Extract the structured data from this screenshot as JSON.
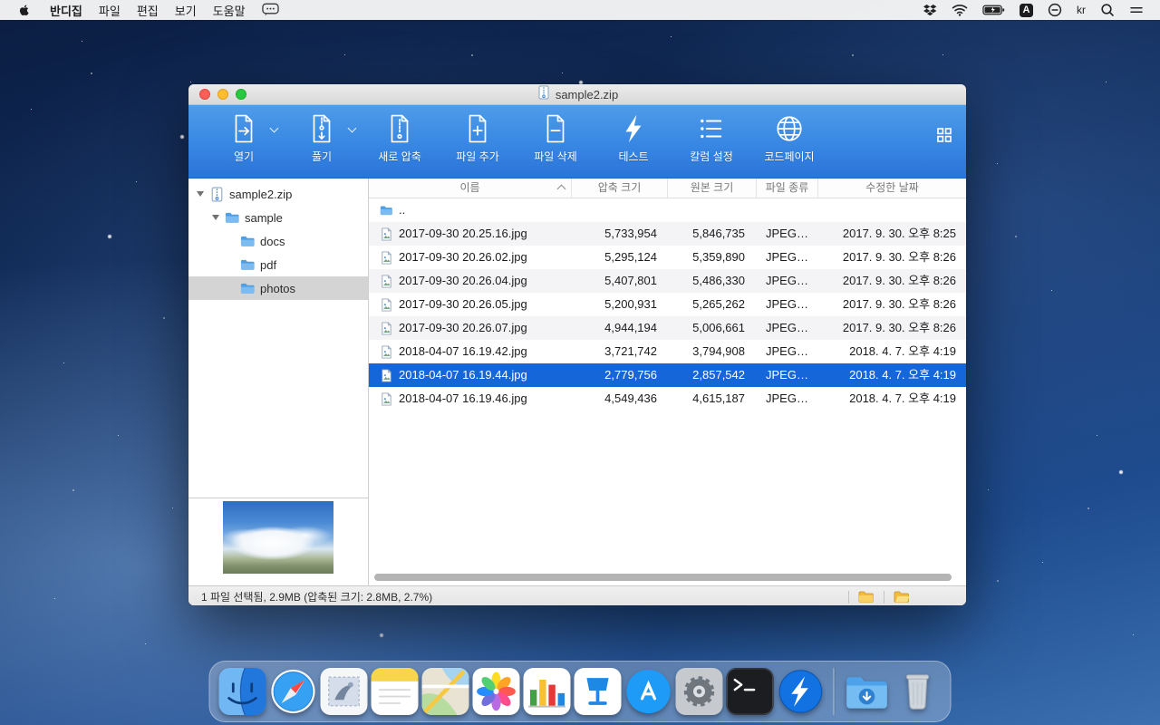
{
  "menubar": {
    "menus": [
      {
        "label": "반디집",
        "bold": true
      },
      {
        "label": "파일",
        "bold": false
      },
      {
        "label": "편집",
        "bold": false
      },
      {
        "label": "보기",
        "bold": false
      },
      {
        "label": "도움말",
        "bold": false
      }
    ],
    "input_badge": "A",
    "language": "kr"
  },
  "window": {
    "title": "sample2.zip",
    "toolbar": {
      "items": [
        {
          "id": "open",
          "label": "열기",
          "chevron": true
        },
        {
          "id": "extract",
          "label": "풀기",
          "chevron": true
        },
        {
          "id": "new-archive",
          "label": "새로 압축",
          "chevron": false
        },
        {
          "id": "add-file",
          "label": "파일 추가",
          "chevron": false
        },
        {
          "id": "delete-file",
          "label": "파일 삭제",
          "chevron": false
        },
        {
          "id": "test",
          "label": "테스트",
          "chevron": false
        },
        {
          "id": "column-settings",
          "label": "칼럼 설정",
          "chevron": false
        },
        {
          "id": "codepage",
          "label": "코드페이지",
          "chevron": false
        }
      ]
    },
    "sidebar": {
      "items": [
        {
          "label": "sample2.zip",
          "icon": "zip-file",
          "depth": 0,
          "expanded": true,
          "selected": false
        },
        {
          "label": "sample",
          "icon": "folder",
          "depth": 1,
          "expanded": true,
          "selected": false
        },
        {
          "label": "docs",
          "icon": "folder",
          "depth": 2,
          "selected": false
        },
        {
          "label": "pdf",
          "icon": "folder",
          "depth": 2,
          "selected": false
        },
        {
          "label": "photos",
          "icon": "folder",
          "depth": 2,
          "selected": true
        }
      ]
    },
    "table": {
      "columns": [
        "이름",
        "압축 크기",
        "원본 크기",
        "파일 종류",
        "수정한 날짜"
      ],
      "rows": [
        {
          "name": "..",
          "icon": "folder-up",
          "packed": "",
          "original": "",
          "type": "",
          "date": "",
          "selected": false
        },
        {
          "name": "2017-09-30 20.25.16.jpg",
          "icon": "image-file",
          "packed": "5,733,954",
          "original": "5,846,735",
          "type": "JPEG…",
          "date": "2017. 9. 30. 오후 8:25",
          "selected": false
        },
        {
          "name": "2017-09-30 20.26.02.jpg",
          "icon": "image-file",
          "packed": "5,295,124",
          "original": "5,359,890",
          "type": "JPEG…",
          "date": "2017. 9. 30. 오후 8:26",
          "selected": false
        },
        {
          "name": "2017-09-30 20.26.04.jpg",
          "icon": "image-file",
          "packed": "5,407,801",
          "original": "5,486,330",
          "type": "JPEG…",
          "date": "2017. 9. 30. 오후 8:26",
          "selected": false
        },
        {
          "name": "2017-09-30 20.26.05.jpg",
          "icon": "image-file",
          "packed": "5,200,931",
          "original": "5,265,262",
          "type": "JPEG…",
          "date": "2017. 9. 30. 오후 8:26",
          "selected": false
        },
        {
          "name": "2017-09-30 20.26.07.jpg",
          "icon": "image-file",
          "packed": "4,944,194",
          "original": "5,006,661",
          "type": "JPEG…",
          "date": "2017. 9. 30. 오후 8:26",
          "selected": false
        },
        {
          "name": "2018-04-07 16.19.42.jpg",
          "icon": "image-file",
          "packed": "3,721,742",
          "original": "3,794,908",
          "type": "JPEG…",
          "date": "2018. 4. 7. 오후 4:19",
          "selected": false
        },
        {
          "name": "2018-04-07 16.19.44.jpg",
          "icon": "image-file",
          "packed": "2,779,756",
          "original": "2,857,542",
          "type": "JPEG…",
          "date": "2018. 4. 7. 오후 4:19",
          "selected": true
        },
        {
          "name": "2018-04-07 16.19.46.jpg",
          "icon": "image-file",
          "packed": "4,549,436",
          "original": "4,615,187",
          "type": "JPEG…",
          "date": "2018. 4. 7. 오후 4:19",
          "selected": false
        }
      ]
    },
    "statusbar": {
      "text": "1 파일 선택됨, 2.9MB (압축된 크기: 2.8MB, 2.7%)"
    }
  },
  "dock": {
    "apps": [
      {
        "id": "finder"
      },
      {
        "id": "safari"
      },
      {
        "id": "mail"
      },
      {
        "id": "notes"
      },
      {
        "id": "maps"
      },
      {
        "id": "photos"
      },
      {
        "id": "numbers"
      },
      {
        "id": "keynote"
      },
      {
        "id": "app-store"
      },
      {
        "id": "system-preferences"
      },
      {
        "id": "terminal"
      },
      {
        "id": "bandizip"
      },
      {
        "id": "separator"
      },
      {
        "id": "downloads"
      },
      {
        "id": "trash"
      }
    ]
  }
}
